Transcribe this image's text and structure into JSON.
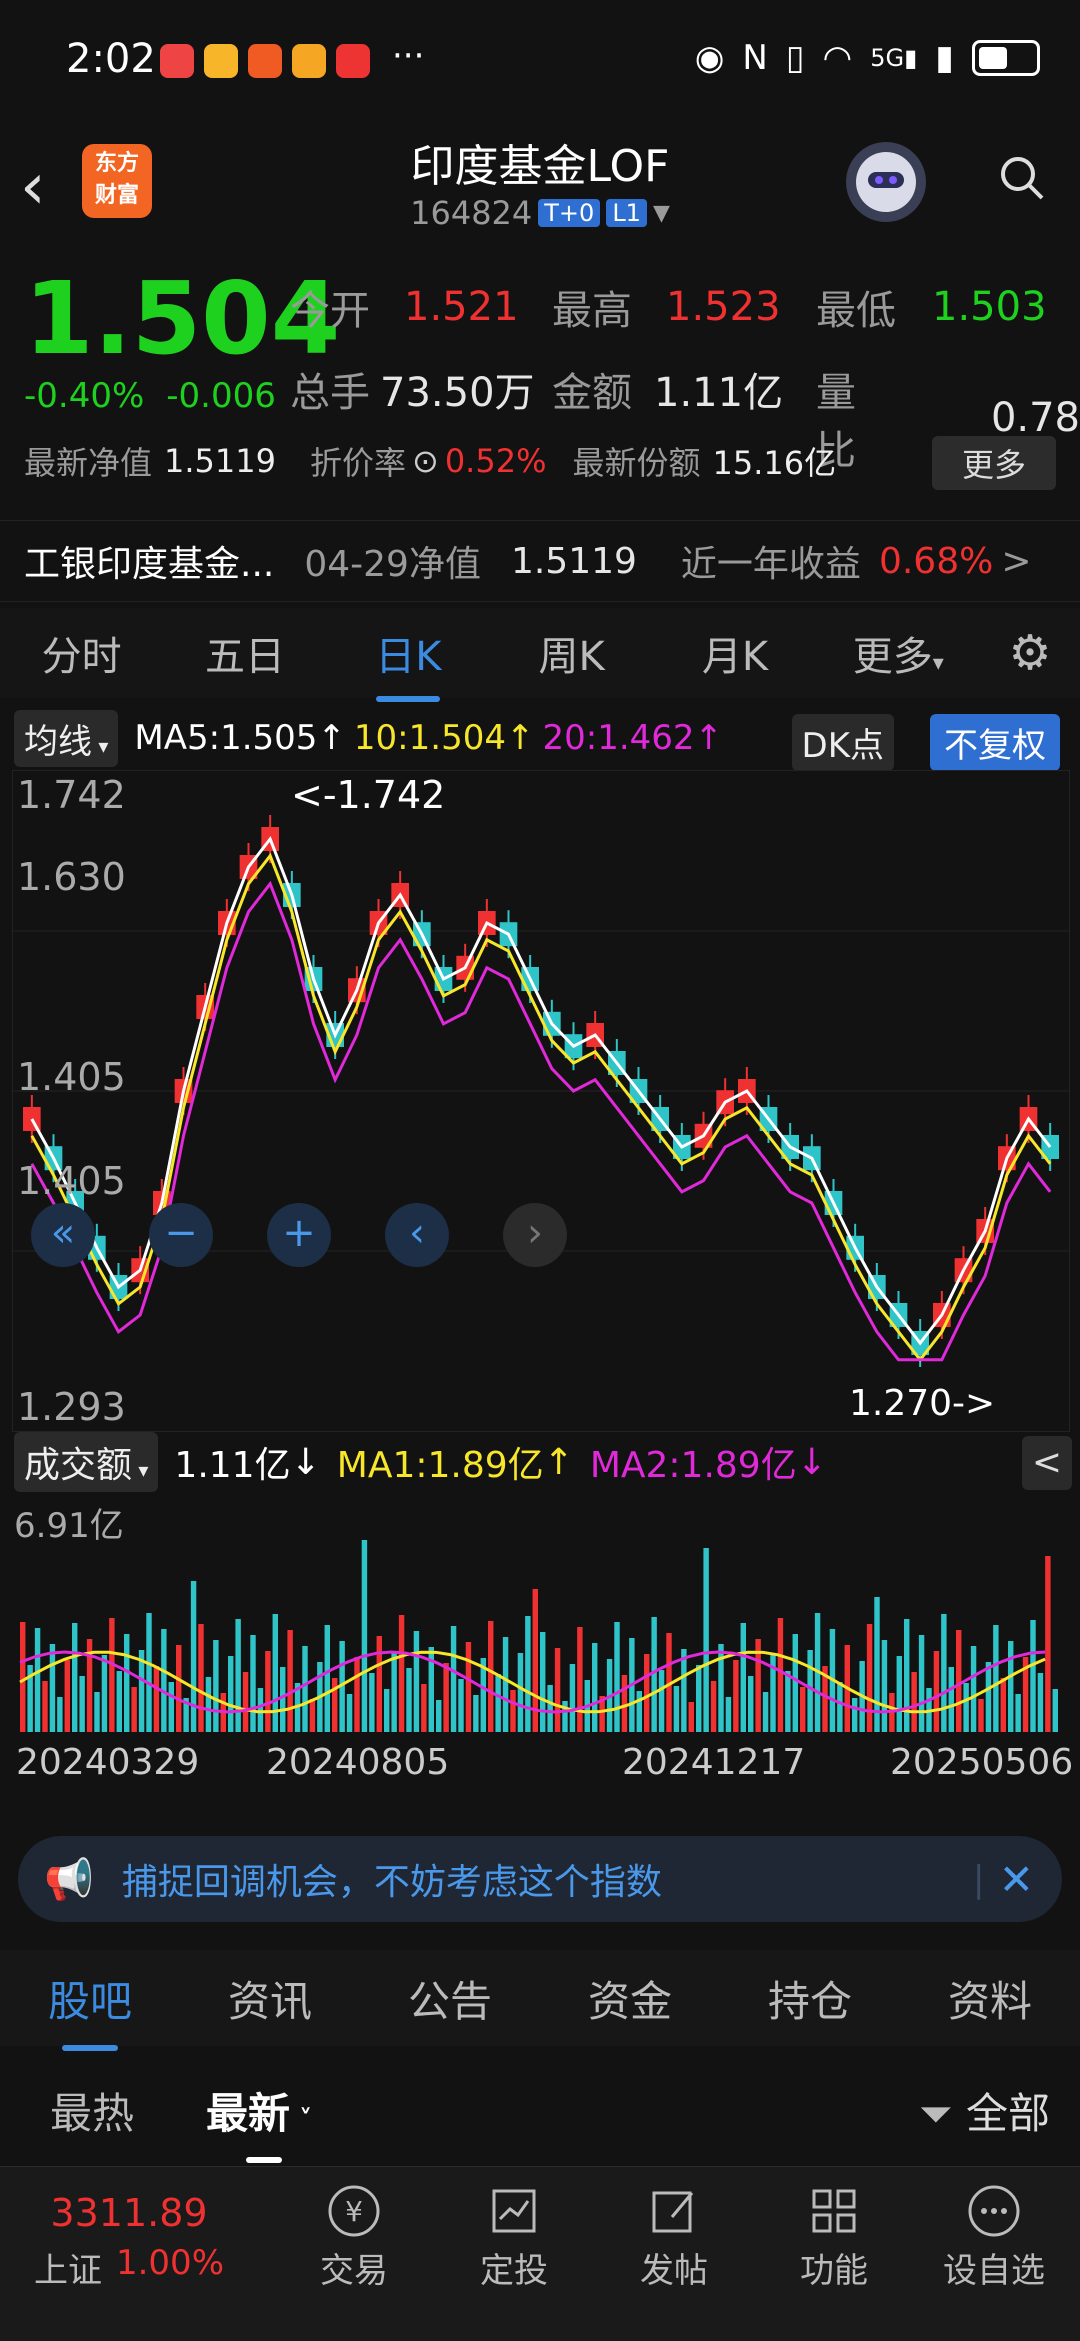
{
  "status": {
    "time": "2:02",
    "more": "···",
    "right_icons": [
      "eye-icon",
      "nfc-icon",
      "vibrate-icon",
      "wifi-icon",
      "5g-signal-icon",
      "signal-icon",
      "battery-icon"
    ]
  },
  "header": {
    "logo_text": "东方\n财富",
    "title": "印度基金LOF",
    "code": "164824",
    "tag1": "T+0",
    "tag2": "L1"
  },
  "quote": {
    "price": "1.504",
    "change_pct": "-0.40%",
    "change_abs": "-0.006",
    "open_label": "今开",
    "open": "1.521",
    "high_label": "最高",
    "high": "1.523",
    "low_label": "最低",
    "low": "1.503",
    "volume_label": "总手",
    "volume": "73.50万",
    "amount_label": "金额",
    "amount": "1.11亿",
    "ratio_label": "量比",
    "ratio": "0.78",
    "nav_label": "最新净值",
    "nav": "1.5119",
    "discount_label": "折价率",
    "discount": "0.52%",
    "shares_label": "最新份额",
    "shares": "15.16亿",
    "more_btn": "更多"
  },
  "fund": {
    "name": "工银印度基金...",
    "nav_date_label": "04-29净值",
    "nav_value": "1.5119",
    "yearly_label": "近一年收益",
    "yearly_value": "0.68%",
    "arrow": ">"
  },
  "tabs": [
    "分时",
    "五日",
    "日K",
    "周K",
    "月K",
    "更多"
  ],
  "ma": {
    "selector": "均线",
    "ma5": "MA5:1.505",
    "ma10": "10:1.504",
    "ma20": "20:1.462",
    "dk": "DK点",
    "fq": "不复权"
  },
  "kchart": {
    "y_top": "1.742",
    "y_2": "1.630",
    "y_3": "1.405",
    "y_bottom": "1.293",
    "high_note": "<-1.742",
    "low_note": "1.270->"
  },
  "volume": {
    "selector": "成交额",
    "value": "1.11亿",
    "ma1": "MA1:1.89亿",
    "ma2": "MA2:1.89亿",
    "max": "6.91亿",
    "collapse": "<"
  },
  "dates": [
    "20240329",
    "20240805",
    "20241217",
    "20250506"
  ],
  "banner": {
    "text": "捕捉回调机会，不妨考虑这个指数"
  },
  "bottom_tabs": [
    "股吧",
    "资讯",
    "公告",
    "资金",
    "持仓",
    "资料"
  ],
  "sort": {
    "hot": "最热",
    "new": "最新",
    "all": "全部"
  },
  "footer": {
    "index_value": "3311.89",
    "index_name": "上证",
    "index_pct": "1.00%",
    "items": [
      "交易",
      "定投",
      "发帖",
      "功能",
      "设自选"
    ]
  },
  "colors": {
    "up": "#f03131",
    "down": "#1fd11f",
    "accent": "#3b8be0",
    "ma10": "#f7e62a",
    "ma20": "#e029d8"
  },
  "chart_data": {
    "type": "candlestick",
    "x": [
      "20240329",
      "20240805",
      "20241217",
      "20250506"
    ],
    "ylim": [
      1.293,
      1.742
    ],
    "series": [
      {
        "name": "MA5",
        "values": [
          1.505
        ]
      },
      {
        "name": "MA10",
        "values": [
          1.504
        ]
      },
      {
        "name": "MA20",
        "values": [
          1.462
        ]
      }
    ]
  }
}
